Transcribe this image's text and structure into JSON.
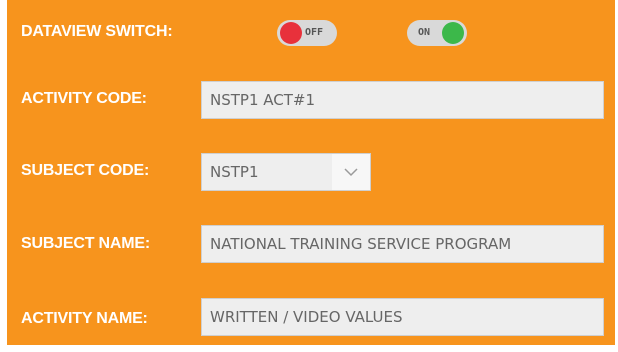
{
  "dataview": {
    "label": "DATAVIEW SWITCH:",
    "off_toggle": {
      "text": "OFF",
      "knob_color": "#e8313b"
    },
    "on_toggle": {
      "text": "ON",
      "knob_color": "#3cb84a"
    }
  },
  "activity_code": {
    "label": "ACTIVITY CODE:",
    "value": "NSTP1 ACT#1"
  },
  "subject_code": {
    "label": "SUBJECT CODE:",
    "value": "NSTP1",
    "arrow_icon": "chevron-down-icon"
  },
  "subject_name": {
    "label": "SUBJECT NAME:",
    "value": "NATIONAL TRAINING SERVICE PROGRAM"
  },
  "activity_name": {
    "label": "ACTIVITY NAME:",
    "value": "WRITTEN / VIDEO VALUES"
  },
  "colors": {
    "panel_background": "#f7941d",
    "label_text": "#ffffff",
    "field_background": "#eeeeee",
    "field_text": "#666666"
  }
}
